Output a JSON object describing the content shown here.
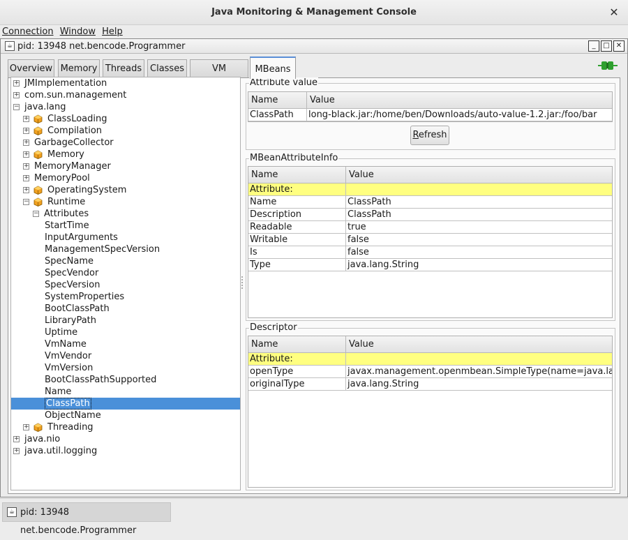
{
  "window": {
    "title": "Java Monitoring & Management Console"
  },
  "menu": [
    "Connection",
    "Window",
    "Help"
  ],
  "internal_frame": {
    "title": "pid: 13948 net.bencode.Programmer"
  },
  "tabs": [
    "Overview",
    "Memory",
    "Threads",
    "Classes",
    "VM Summary",
    "MBeans"
  ],
  "active_tab": "MBeans",
  "tree": [
    {
      "label": "JMImplementation",
      "exp": "+",
      "icon": false
    },
    {
      "label": "com.sun.management",
      "exp": "+",
      "icon": false
    },
    {
      "label": "java.lang",
      "exp": "-",
      "icon": false
    },
    {
      "label": "ClassLoading",
      "exp": "+",
      "icon": true
    },
    {
      "label": "Compilation",
      "exp": "+",
      "icon": true
    },
    {
      "label": "GarbageCollector",
      "exp": "+",
      "icon": false
    },
    {
      "label": "Memory",
      "exp": "+",
      "icon": true
    },
    {
      "label": "MemoryManager",
      "exp": "+",
      "icon": false
    },
    {
      "label": "MemoryPool",
      "exp": "+",
      "icon": false
    },
    {
      "label": "OperatingSystem",
      "exp": "+",
      "icon": true
    },
    {
      "label": "Runtime",
      "exp": "-",
      "icon": true
    },
    {
      "label": "Attributes",
      "exp": "-",
      "icon": false
    },
    {
      "label": "StartTime"
    },
    {
      "label": "InputArguments"
    },
    {
      "label": "ManagementSpecVersion"
    },
    {
      "label": "SpecName"
    },
    {
      "label": "SpecVendor"
    },
    {
      "label": "SpecVersion"
    },
    {
      "label": "SystemProperties"
    },
    {
      "label": "BootClassPath"
    },
    {
      "label": "LibraryPath"
    },
    {
      "label": "Uptime"
    },
    {
      "label": "VmName"
    },
    {
      "label": "VmVendor"
    },
    {
      "label": "VmVersion"
    },
    {
      "label": "BootClassPathSupported"
    },
    {
      "label": "Name"
    },
    {
      "label": "ClassPath",
      "selected": true
    },
    {
      "label": "ObjectName"
    },
    {
      "label": "Threading",
      "exp": "+",
      "icon": true
    },
    {
      "label": "java.nio",
      "exp": "+",
      "icon": false
    },
    {
      "label": "java.util.logging",
      "exp": "+",
      "icon": false
    }
  ],
  "attribute_value": {
    "title": "Attribute value",
    "headers": [
      "Name",
      "Value"
    ],
    "row": [
      "ClassPath",
      "long-black.jar:/home/ben/Downloads/auto-value-1.2.jar:/foo/bar"
    ],
    "refresh_label": "Refresh"
  },
  "mbean_info": {
    "title": "MBeanAttributeInfo",
    "headers": [
      "Name",
      "Value"
    ],
    "section": "Attribute:",
    "rows": [
      [
        "Name",
        "ClassPath"
      ],
      [
        "Description",
        "ClassPath"
      ],
      [
        "Readable",
        "true"
      ],
      [
        "Writable",
        "false"
      ],
      [
        "Is",
        "false"
      ],
      [
        "Type",
        "java.lang.String"
      ]
    ]
  },
  "descriptor": {
    "title": "Descriptor",
    "headers": [
      "Name",
      "Value"
    ],
    "section": "Attribute:",
    "rows": [
      [
        "openType",
        "javax.management.openmbean.SimpleType(name=java.lang.Str..."
      ],
      [
        "originalType",
        "java.lang.String"
      ]
    ]
  },
  "taskbar": {
    "label": "pid: 13948 net.bencode.Programmer"
  },
  "colors": {
    "selection": "#4a90d9",
    "highlight_row": "#ffff80",
    "connected": "#2ea02e"
  }
}
